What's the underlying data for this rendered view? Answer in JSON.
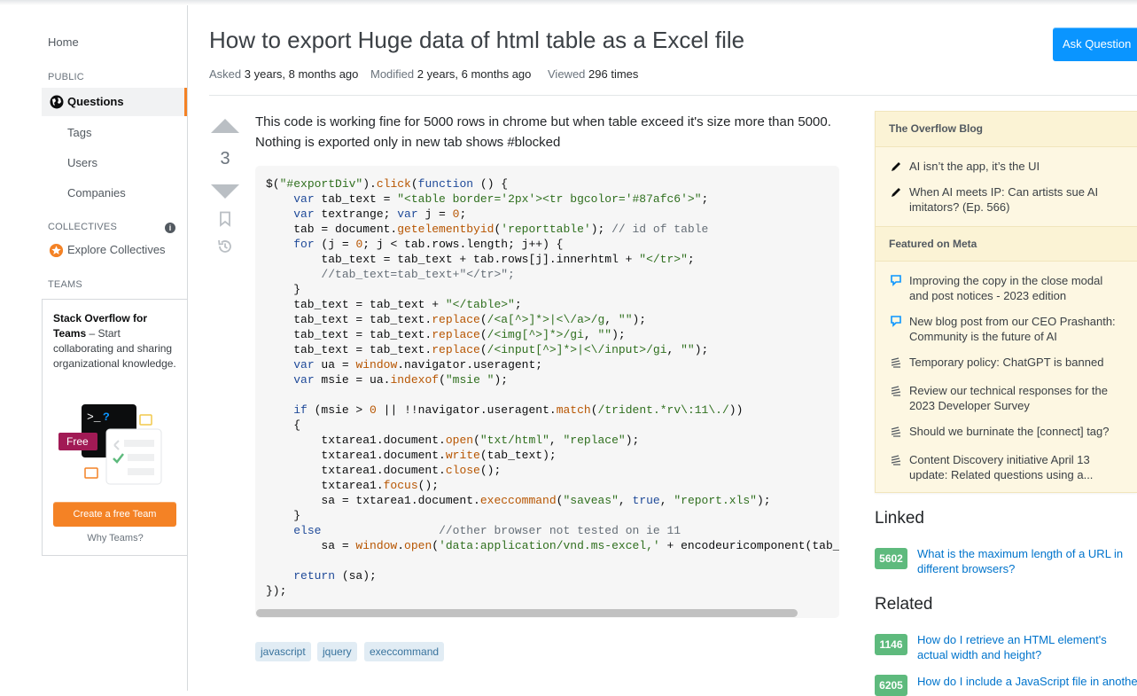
{
  "nav": {
    "home": "Home",
    "public_label": "PUBLIC",
    "questions": "Questions",
    "tags": "Tags",
    "users": "Users",
    "companies": "Companies",
    "collectives_label": "COLLECTIVES",
    "explore_collectives": "Explore Collectives",
    "teams_label": "TEAMS",
    "teams_title": "Stack Overflow for Teams",
    "teams_desc": " – Start collaborating and sharing organizational knowledge.",
    "free_badge": "Free",
    "create_team": "Create a free Team",
    "why_teams": "Why Teams?"
  },
  "question": {
    "title": "How to export Huge data of html table as a Excel file",
    "ask_button": "Ask Question",
    "asked_label": "Asked",
    "asked_value": "3 years, 8 months ago",
    "modified_label": "Modified",
    "modified_value": "2 years, 6 months ago",
    "viewed_label": "Viewed",
    "viewed_value": "296 times",
    "score": "3",
    "body": "This code is working fine for 5000 rows in chrome but when table exceed it's size more than 5000. Nothing is exported only in new tab shows #blocked",
    "tags": [
      "javascript",
      "jquery",
      "execcommand"
    ]
  },
  "code_lines": [
    "$(\"#exportDiv\").click(function () {",
    "    var tab_text = \"<table border='2px'><tr bgcolor='#87afc6'>\";",
    "    var textrange; var j = 0;",
    "    tab = document.getelementbyid('reporttable'); // id of table",
    "    for (j = 0; j < tab.rows.length; j++) {",
    "        tab_text = tab_text + tab.rows[j].innerhtml + \"</tr>\";",
    "        //tab_text=tab_text+\"</tr>\";",
    "    }",
    "    tab_text = tab_text + \"</table>\";",
    "    tab_text = tab_text.replace(/<a[^>]*>|<\\/a>/g, \"\");",
    "    tab_text = tab_text.replace(/<img[^>]*>/gi, \"\");",
    "    tab_text = tab_text.replace(/<input[^>]*>|<\\/input>/gi, \"\");",
    "    var ua = window.navigator.useragent;",
    "    var msie = ua.indexof(\"msie \");",
    "",
    "    if (msie > 0 || !!navigator.useragent.match(/trident.*rv\\:11\\./))",
    "    {",
    "        txtarea1.document.open(\"txt/html\", \"replace\");",
    "        txtarea1.document.write(tab_text);",
    "        txtarea1.document.close();",
    "        txtarea1.focus();",
    "        sa = txtarea1.document.execcommand(\"saveas\", true, \"report.xls\");",
    "    }",
    "    else                 //other browser not tested on ie 11",
    "        sa = window.open('data:application/vnd.ms-excel,' + encodeuricomponent(tab_te",
    "",
    "    return (sa);",
    "});"
  ],
  "sidebar": {
    "blog_title": "The Overflow Blog",
    "blog_items": [
      "AI isn’t the app, it’s the UI",
      "When AI meets IP: Can artists sue AI imitators? (Ep. 566)"
    ],
    "meta_title": "Featured on Meta",
    "meta_items": [
      "Improving the copy in the close modal and post notices - 2023 edition",
      "New blog post from our CEO Prashanth: Community is the future of AI",
      "Temporary policy: ChatGPT is banned",
      "Review our technical responses for the 2023 Developer Survey",
      "Should we burninate the [connect] tag?",
      "Content Discovery initiative April 13 update: Related questions using a..."
    ],
    "linked_title": "Linked",
    "linked": [
      {
        "score": "5602",
        "title": "What is the maximum length of a URL in different browsers?"
      }
    ],
    "related_title": "Related",
    "related": [
      {
        "score": "1146",
        "title": "How do I retrieve an HTML element's actual width and height?"
      },
      {
        "score": "6205",
        "title": "How do I include a JavaScript file in another"
      }
    ]
  },
  "colors": {
    "accent_orange": "#f48225",
    "ask_blue": "#0a95ff",
    "link_blue": "#0074cc",
    "score_green": "#5eba7d",
    "blog_bg": "#fdf7e2"
  }
}
